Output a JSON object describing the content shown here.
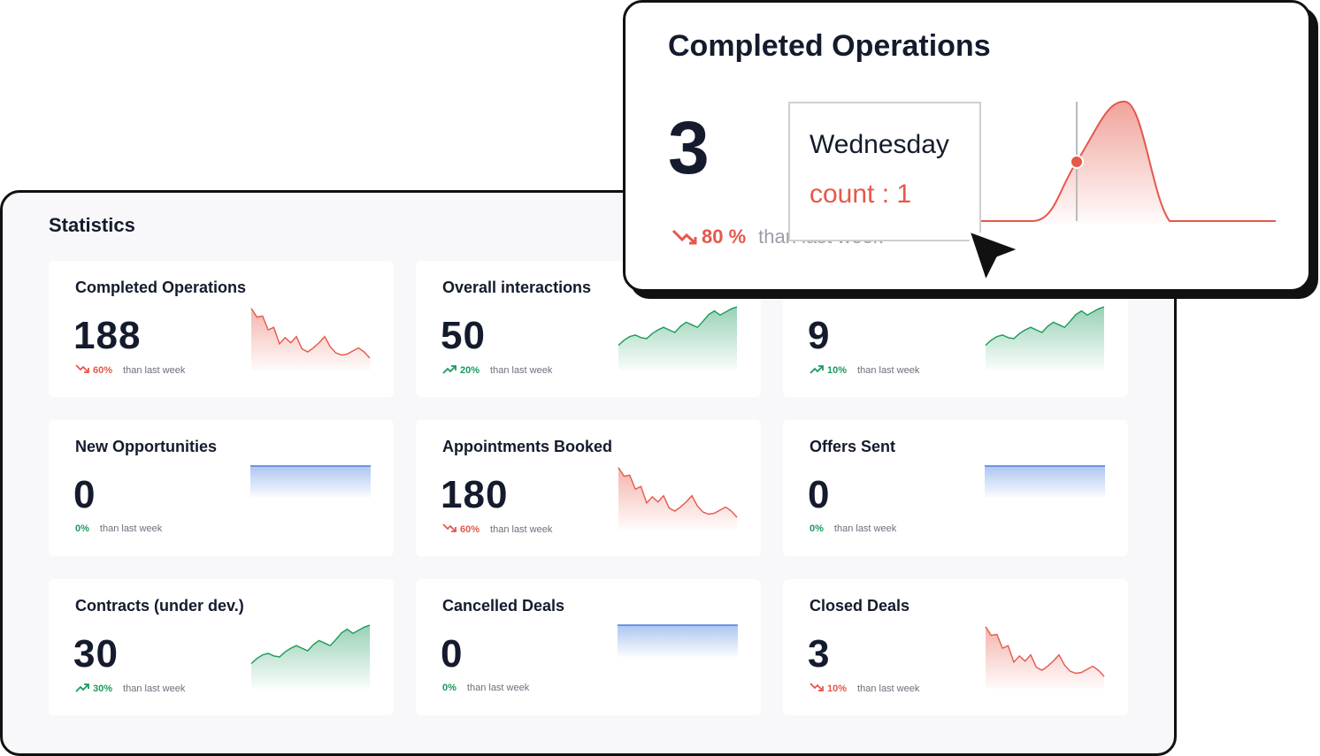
{
  "statistics": {
    "title": "Statistics",
    "cards": [
      {
        "title": "Completed Operations",
        "value": "188",
        "trend": "down",
        "pct": "60%",
        "compare": "than last week",
        "spark": [
          0.97,
          0.8,
          0.82,
          0.55,
          0.6,
          0.28,
          0.4,
          0.3,
          0.42,
          0.18,
          0.12,
          0.2,
          0.3,
          0.42,
          0.22,
          0.1,
          0.06,
          0.08,
          0.14,
          0.2,
          0.12,
          0.0
        ]
      },
      {
        "title": "Overall interactions",
        "value": "50",
        "trend": "up",
        "pct": "20%",
        "compare": "than last week",
        "spark": [
          0.25,
          0.35,
          0.42,
          0.45,
          0.4,
          0.38,
          0.48,
          0.55,
          0.6,
          0.55,
          0.5,
          0.62,
          0.7,
          0.65,
          0.6,
          0.72,
          0.85,
          0.92,
          0.84,
          0.9,
          0.96,
          1.0
        ]
      },
      {
        "title": "",
        "value": "9",
        "trend": "up",
        "pct": "10%",
        "compare": "than last week",
        "spark": [
          0.25,
          0.35,
          0.42,
          0.45,
          0.4,
          0.38,
          0.48,
          0.55,
          0.6,
          0.55,
          0.5,
          0.62,
          0.7,
          0.65,
          0.6,
          0.72,
          0.85,
          0.92,
          0.84,
          0.9,
          0.96,
          1.0
        ]
      },
      {
        "title": "New Opportunities",
        "value": "0",
        "trend": "flat",
        "pct": "0%",
        "compare": "than last week",
        "spark": []
      },
      {
        "title": "Appointments Booked",
        "value": "180",
        "trend": "down",
        "pct": "60%",
        "compare": "than last week",
        "spark": [
          0.97,
          0.8,
          0.82,
          0.55,
          0.6,
          0.28,
          0.4,
          0.3,
          0.42,
          0.18,
          0.12,
          0.2,
          0.3,
          0.42,
          0.22,
          0.1,
          0.06,
          0.08,
          0.14,
          0.2,
          0.12,
          0.0
        ]
      },
      {
        "title": "Offers Sent",
        "value": "0",
        "trend": "flat",
        "pct": "0%",
        "compare": "than last week",
        "spark": []
      },
      {
        "title": "Contracts (under dev.)",
        "value": "30",
        "trend": "up",
        "pct": "30%",
        "compare": "than last week",
        "spark": [
          0.25,
          0.35,
          0.42,
          0.45,
          0.4,
          0.38,
          0.48,
          0.55,
          0.6,
          0.55,
          0.5,
          0.62,
          0.7,
          0.65,
          0.6,
          0.72,
          0.85,
          0.92,
          0.84,
          0.9,
          0.96,
          1.0
        ]
      },
      {
        "title": "Cancelled Deals",
        "value": "0",
        "trend": "flat",
        "pct": "0%",
        "compare": "than last week",
        "spark": []
      },
      {
        "title": "Closed Deals",
        "value": "3",
        "trend": "down",
        "pct": "10%",
        "compare": "than last week",
        "spark": [
          0.97,
          0.8,
          0.82,
          0.55,
          0.6,
          0.28,
          0.4,
          0.3,
          0.42,
          0.18,
          0.12,
          0.2,
          0.3,
          0.42,
          0.22,
          0.1,
          0.06,
          0.08,
          0.14,
          0.2,
          0.12,
          0.0
        ]
      }
    ]
  },
  "popup": {
    "title": "Completed Operations",
    "value": "3",
    "trend": "down",
    "pct": "80 %",
    "compare": "than last week",
    "tooltip": {
      "day": "Wednesday",
      "count": "count : 1"
    }
  },
  "colors": {
    "up": "#1a9a5a",
    "down": "#e5584a",
    "flat": "#4a7fe0",
    "text": "#141b2d"
  },
  "icons": {
    "trend_up": "trending-up-icon",
    "trend_down": "trending-down-icon",
    "cursor": "pointer-cursor-icon"
  }
}
